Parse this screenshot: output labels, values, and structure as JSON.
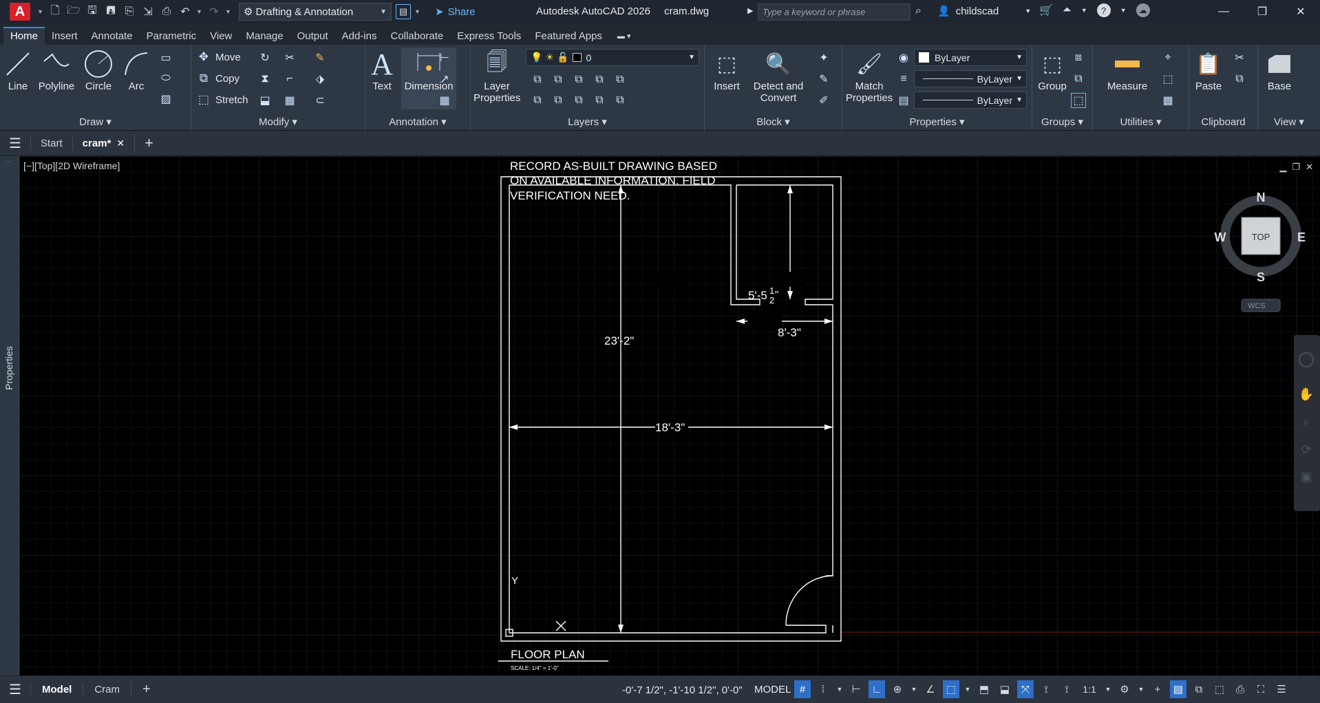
{
  "titlebar": {
    "app_logo": "A",
    "workspace": "Drafting & Annotation",
    "share": "Share",
    "app_name": "Autodesk AutoCAD 2026",
    "file_name": "cram.dwg",
    "search_placeholder": "Type a keyword or phrase",
    "user": "childscad"
  },
  "ribbon_tabs": [
    "Home",
    "Insert",
    "Annotate",
    "Parametric",
    "View",
    "Manage",
    "Output",
    "Add-ins",
    "Collaborate",
    "Express Tools",
    "Featured Apps"
  ],
  "ribbon": {
    "draw": {
      "title": "Draw",
      "line": "Line",
      "polyline": "Polyline",
      "circle": "Circle",
      "arc": "Arc"
    },
    "modify": {
      "title": "Modify",
      "move": "Move",
      "copy": "Copy",
      "stretch": "Stretch"
    },
    "annotation": {
      "title": "Annotation",
      "text": "Text",
      "dimension": "Dimension"
    },
    "layers": {
      "title": "Layers",
      "layer_properties_1": "Layer",
      "layer_properties_2": "Properties",
      "current_layer": "0"
    },
    "block": {
      "title": "Block",
      "insert": "Insert",
      "detect_1": "Detect and",
      "detect_2": "Convert"
    },
    "properties": {
      "title": "Properties",
      "match_1": "Match",
      "match_2": "Properties",
      "color": "ByLayer",
      "linetype": "ByLayer",
      "lineweight": "ByLayer"
    },
    "groups": {
      "title": "Groups",
      "group": "Group"
    },
    "utilities": {
      "title": "Utilities",
      "measure": "Measure"
    },
    "clipboard": {
      "title": "Clipboard",
      "paste": "Paste"
    },
    "view": {
      "title": "View",
      "base": "Base"
    }
  },
  "file_tabs": {
    "start": "Start",
    "current": "cram*"
  },
  "viewport": {
    "label": "[−][Top][2D Wireframe]",
    "properties_label": "Properties",
    "note_line1": "RECORD AS-BUILT DRAWING BASED",
    "note_line2": "ON AVAILABLE INFORMATION. FIELD",
    "note_line3": "VERIFICATION NEED.",
    "dim_height": "23'-2\"",
    "dim_width": "18'-3\"",
    "dim_closet_height": "8'-3\"",
    "dim_closet_width": "5'-5",
    "dim_closet_frac_num": "1",
    "dim_closet_frac_den": "2",
    "dim_closet_inch": "\"",
    "title": "FLOOR PLAN",
    "scale": "SCALE: 1/4\" = 1'-0\"",
    "ucs_y": "Y",
    "viewcube": {
      "n": "N",
      "s": "S",
      "e": "E",
      "w": "W",
      "top": "TOP",
      "wcs": "WCS"
    }
  },
  "statusbar": {
    "model_tab": "Model",
    "layout_tab": "Cram",
    "coords": "-0'-7 1/2\", -1'-10 1/2\", 0'-0\"",
    "model": "MODEL",
    "scale": "1:1"
  },
  "colors": {
    "accent": "#2d8cf0",
    "logo": "#d8202a",
    "canvas": "#000000",
    "ribbon": "#2e3845"
  }
}
